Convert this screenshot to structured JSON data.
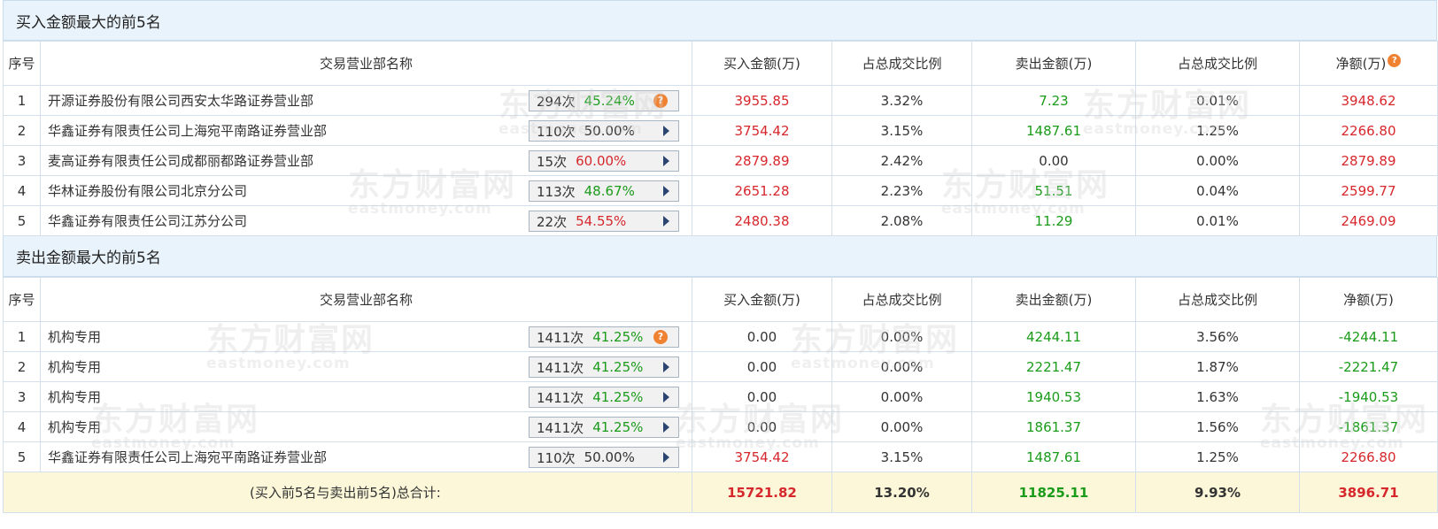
{
  "buy_section": {
    "title": "买入金额最大的前5名",
    "headers": [
      "序号",
      "交易营业部名称",
      "买入金额(万)",
      "占总成交比例",
      "卖出金额(万)",
      "占总成交比例",
      "净额(万)"
    ],
    "rows": [
      {
        "idx": "1",
        "name": "开源证券股份有限公司西安太华路证券营业部",
        "count": "294次",
        "pct": "45.24%",
        "pct_color": "green",
        "control": "help",
        "buy": "3955.85",
        "buy_pct": "3.32%",
        "sell": "7.23",
        "sell_pct": "0.01%",
        "net": "3948.62"
      },
      {
        "idx": "2",
        "name": "华鑫证券有限责任公司上海宛平南路证券营业部",
        "count": "110次",
        "pct": "50.00%",
        "pct_color": "neutral",
        "control": "arrow",
        "buy": "3754.42",
        "buy_pct": "3.15%",
        "sell": "1487.61",
        "sell_pct": "1.25%",
        "net": "2266.80"
      },
      {
        "idx": "3",
        "name": "麦高证券有限责任公司成都丽都路证券营业部",
        "count": "15次",
        "pct": "60.00%",
        "pct_color": "red",
        "control": "arrow",
        "buy": "2879.89",
        "buy_pct": "2.42%",
        "sell": "0.00",
        "sell_pct": "0.00%",
        "net": "2879.89"
      },
      {
        "idx": "4",
        "name": "华林证券股份有限公司北京分公司",
        "count": "113次",
        "pct": "48.67%",
        "pct_color": "green",
        "control": "arrow",
        "buy": "2651.28",
        "buy_pct": "2.23%",
        "sell": "51.51",
        "sell_pct": "0.04%",
        "net": "2599.77"
      },
      {
        "idx": "5",
        "name": "华鑫证券有限责任公司江苏分公司",
        "count": "22次",
        "pct": "54.55%",
        "pct_color": "red",
        "control": "arrow",
        "buy": "2480.38",
        "buy_pct": "2.08%",
        "sell": "11.29",
        "sell_pct": "0.01%",
        "net": "2469.09"
      }
    ]
  },
  "sell_section": {
    "title": "卖出金额最大的前5名",
    "headers": [
      "序号",
      "交易营业部名称",
      "买入金额(万)",
      "占总成交比例",
      "卖出金额(万)",
      "占总成交比例",
      "净额(万)"
    ],
    "rows": [
      {
        "idx": "1",
        "name": "机构专用",
        "count": "1411次",
        "pct": "41.25%",
        "pct_color": "green",
        "control": "help",
        "buy": "0.00",
        "buy_pct": "0.00%",
        "sell": "4244.11",
        "sell_pct": "3.56%",
        "net": "-4244.11"
      },
      {
        "idx": "2",
        "name": "机构专用",
        "count": "1411次",
        "pct": "41.25%",
        "pct_color": "green",
        "control": "arrow",
        "buy": "0.00",
        "buy_pct": "0.00%",
        "sell": "2221.47",
        "sell_pct": "1.87%",
        "net": "-2221.47"
      },
      {
        "idx": "3",
        "name": "机构专用",
        "count": "1411次",
        "pct": "41.25%",
        "pct_color": "green",
        "control": "arrow",
        "buy": "0.00",
        "buy_pct": "0.00%",
        "sell": "1940.53",
        "sell_pct": "1.63%",
        "net": "-1940.53"
      },
      {
        "idx": "4",
        "name": "机构专用",
        "count": "1411次",
        "pct": "41.25%",
        "pct_color": "green",
        "control": "arrow",
        "buy": "0.00",
        "buy_pct": "0.00%",
        "sell": "1861.37",
        "sell_pct": "1.56%",
        "net": "-1861.37"
      },
      {
        "idx": "5",
        "name": "华鑫证券有限责任公司上海宛平南路证券营业部",
        "count": "110次",
        "pct": "50.00%",
        "pct_color": "neutral",
        "control": "arrow",
        "buy": "3754.42",
        "buy_pct": "3.15%",
        "sell": "1487.61",
        "sell_pct": "1.25%",
        "net": "2266.80"
      }
    ]
  },
  "total": {
    "label": "(买入前5名与卖出前5名)总合计:",
    "buy": "15721.82",
    "buy_pct": "13.20%",
    "sell": "11825.11",
    "sell_pct": "9.93%",
    "net": "3896.71"
  },
  "help_glyph": "?",
  "watermark": {
    "cn": "东方财富网",
    "en": "eastmoney.com"
  },
  "colors": {
    "up": "#d6272c",
    "down": "#1a9b1a",
    "header_bg": "#e9f3fb",
    "total_bg": "#fbf7d8",
    "help": "#f08131"
  }
}
